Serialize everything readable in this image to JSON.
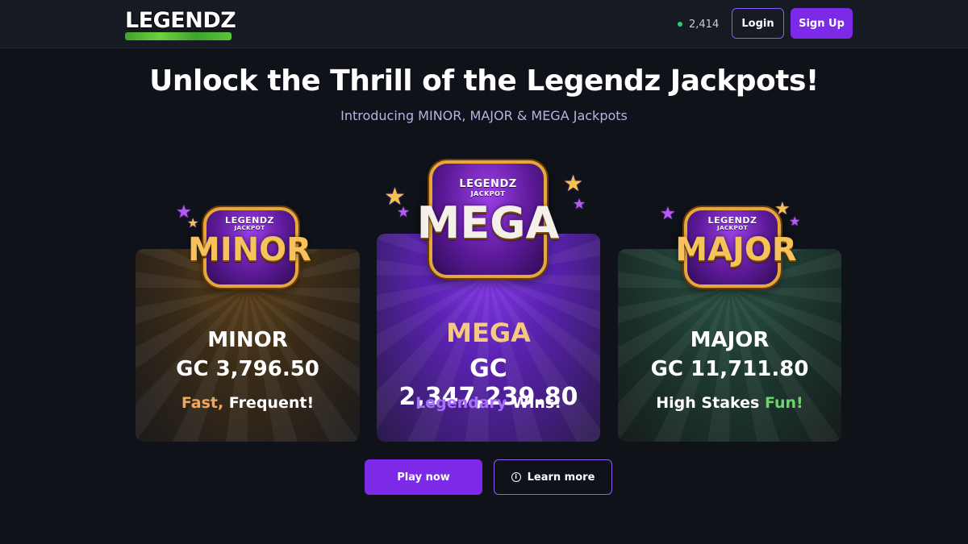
{
  "header": {
    "logo_text": "LEGENDZ",
    "online_count": "2,414",
    "login_label": "Login",
    "signup_label": "Sign Up"
  },
  "hero": {
    "title": "Unlock the Thrill of the Legendz Jackpots!",
    "subtitle": "Introducing MINOR, MAJOR & MEGA Jackpots"
  },
  "jackpots": [
    {
      "badge_brand": "LEGENDZ",
      "badge_sub": "JACKPOT",
      "badge_word": "MINOR",
      "name": "MINOR",
      "amount": "GC 3,796.50",
      "tag_accent": "Fast,",
      "tag_rest": " Frequent!",
      "accent_color": "#f2a65a"
    },
    {
      "badge_brand": "LEGENDZ",
      "badge_sub": "JACKPOT",
      "badge_word": "MEGA",
      "name": "MEGA",
      "amount": "GC 2,347,239.80",
      "tag_accent": "Legendary",
      "tag_rest": " Wins!",
      "accent_color": "#a970ff"
    },
    {
      "badge_brand": "LEGENDZ",
      "badge_sub": "JACKPOT",
      "badge_word": "MAJOR",
      "name": "MAJOR",
      "amount": "GC 11,711.80",
      "tag_pre": "High Stakes ",
      "tag_accent": "Fun!",
      "accent_color": "#6ed36b"
    }
  ],
  "cta": {
    "play_label": "Play now",
    "learn_label": "Learn more"
  },
  "colors": {
    "brand_purple": "#7c2ae8",
    "online_green": "#2ecc71",
    "background": "#0f1219"
  },
  "icons": {
    "online": "status-dot-icon",
    "learn": "info-circle-icon"
  }
}
